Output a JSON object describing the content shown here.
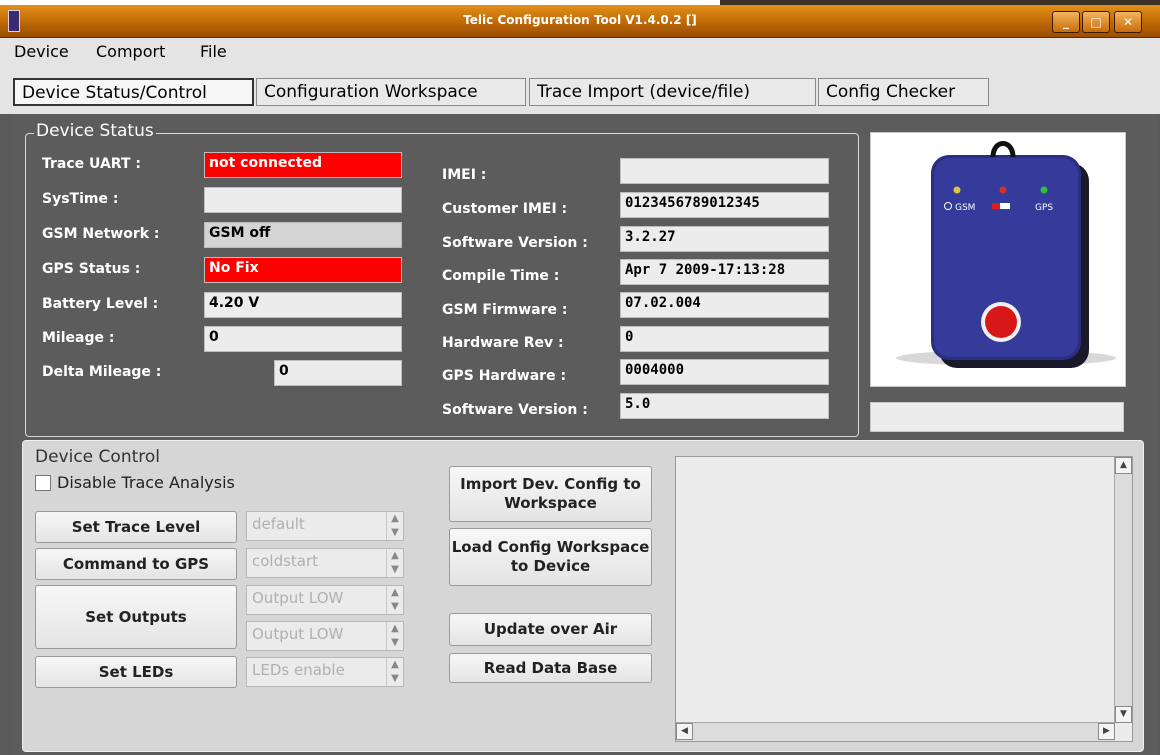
{
  "window": {
    "title": "Telic Configuration Tool V1.4.0.2 []",
    "controls": {
      "minimize": "_",
      "maximize": "□",
      "close": "✕"
    }
  },
  "menu": [
    "Device",
    "Comport",
    "File"
  ],
  "tabs": [
    "Device Status/Control",
    "Configuration Workspace",
    "Trace Import (device/file)",
    "Config Checker"
  ],
  "status": {
    "title": "Device Status",
    "trace_uart": {
      "label": "Trace UART :",
      "value": "not connected"
    },
    "systime": {
      "label": "SysTime :",
      "value": ""
    },
    "gsm_network": {
      "label": "GSM Network :",
      "value": "GSM off"
    },
    "gps_status": {
      "label": "GPS Status :",
      "value": "No Fix"
    },
    "battery_level": {
      "label": "Battery Level :",
      "value": "4.20 V"
    },
    "mileage": {
      "label": "Mileage :",
      "value": "0"
    },
    "delta_mileage": {
      "label": "Delta Mileage :",
      "value": "0"
    },
    "imei": {
      "label": "IMEI :",
      "value": ""
    },
    "customer_imei": {
      "label": "Customer IMEI :",
      "value": "0123456789012345"
    },
    "software_version": {
      "label": "Software Version :",
      "value": "3.2.27"
    },
    "compile_time": {
      "label": "Compile Time :",
      "value": "Apr  7 2009-17:13:28"
    },
    "gsm_firmware": {
      "label": "GSM Firmware :",
      "value": "07.02.004"
    },
    "hardware_rev": {
      "label": "Hardware Rev :",
      "value": "0"
    },
    "gps_hardware": {
      "label": "GPS Hardware :",
      "value": "0004000"
    },
    "gps_software_version": {
      "label": "Software Version :",
      "value": "5.0"
    }
  },
  "device_image": {
    "led_labels": {
      "gsm": "GSM",
      "gps": "GPS"
    }
  },
  "control": {
    "title": "Device Control",
    "disable_trace_label": "Disable Trace Analysis",
    "set_trace_level": {
      "label": "Set Trace Level",
      "combo": "default"
    },
    "command_to_gps": {
      "label": "Command to GPS",
      "combo": "coldstart"
    },
    "set_outputs": {
      "label": "Set Outputs",
      "combo1": "Output LOW",
      "combo2": "Output LOW"
    },
    "set_leds": {
      "label": "Set LEDs",
      "combo": "LEDs enable"
    },
    "import_config": "Import Dev. Config to Workspace",
    "load_config": "Load Config Workspace to Device",
    "update_over_air": "Update over Air",
    "read_database": "Read Data Base"
  },
  "colors": {
    "title_bar": "#c66f08",
    "alert_red": "#ff0000",
    "panel_dark": "#5c5c5c",
    "panel_light": "#d6d6d6"
  }
}
